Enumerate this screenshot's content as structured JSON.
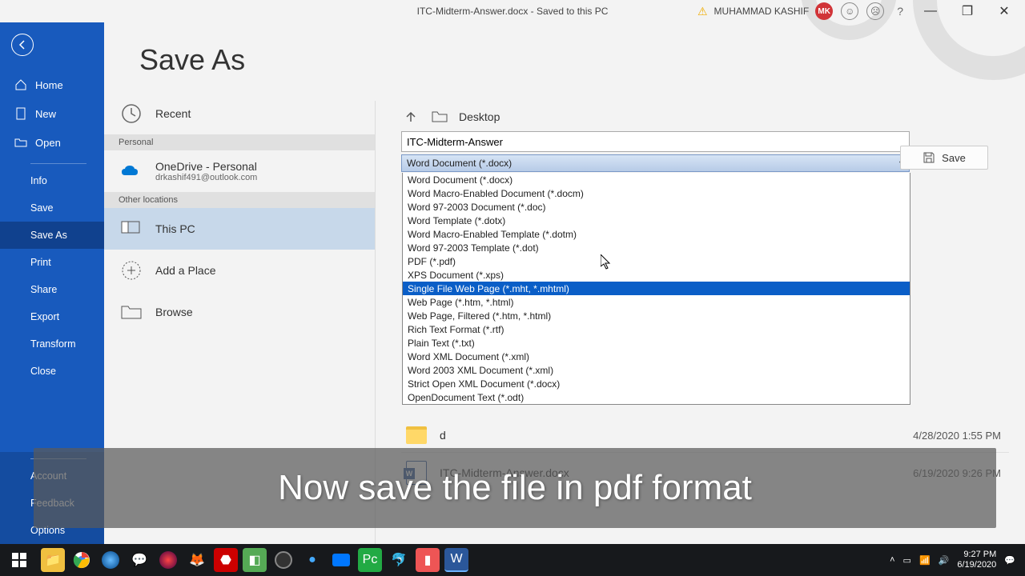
{
  "title_bar": {
    "doc_title": "ITC-Midterm-Answer.docx  -  Saved to this PC",
    "user_name": "MUHAMMAD KASHIF",
    "user_initials": "MK",
    "help": "?"
  },
  "sidebar": {
    "items": [
      {
        "label": "Home"
      },
      {
        "label": "New"
      },
      {
        "label": "Open"
      }
    ],
    "sub_items": [
      {
        "label": "Info"
      },
      {
        "label": "Save"
      },
      {
        "label": "Save As"
      },
      {
        "label": "Print"
      },
      {
        "label": "Share"
      },
      {
        "label": "Export"
      },
      {
        "label": "Transform"
      },
      {
        "label": "Close"
      }
    ],
    "bottom": [
      {
        "label": "Account"
      },
      {
        "label": "Feedback"
      },
      {
        "label": "Options"
      }
    ]
  },
  "page_title": "Save As",
  "locations": {
    "recent": "Recent",
    "personal_header": "Personal",
    "onedrive_title": "OneDrive - Personal",
    "onedrive_email": "drkashif491@outlook.com",
    "other_header": "Other locations",
    "this_pc": "This PC",
    "add_place": "Add a Place",
    "browse": "Browse"
  },
  "right": {
    "path": "Desktop",
    "filename": "ITC-Midterm-Answer",
    "selected_format": "Word Document (*.docx)",
    "save_label": "Save",
    "formats": [
      "Word Document (*.docx)",
      "Word Macro-Enabled Document (*.docm)",
      "Word 97-2003 Document (*.doc)",
      "Word Template (*.dotx)",
      "Word Macro-Enabled Template (*.dotm)",
      "Word 97-2003 Template (*.dot)",
      "PDF (*.pdf)",
      "XPS Document (*.xps)",
      "Single File Web Page (*.mht, *.mhtml)",
      "Web Page (*.htm, *.html)",
      "Web Page, Filtered (*.htm, *.html)",
      "Rich Text Format (*.rtf)",
      "Plain Text (*.txt)",
      "Word XML Document (*.xml)",
      "Word 2003 XML Document (*.xml)",
      "Strict Open XML Document (*.docx)",
      "OpenDocument Text (*.odt)"
    ],
    "highlight_index": 8
  },
  "files": [
    {
      "name": "d",
      "date": "4/28/2020 1:55 PM",
      "type": "folder"
    },
    {
      "name": "ITC-Midterm-Answer.docx",
      "date": "6/19/2020 9:26 PM",
      "type": "docx"
    }
  ],
  "caption": "Now save the file in pdf format",
  "taskbar": {
    "time": "9:27 PM",
    "date": "6/19/2020"
  }
}
